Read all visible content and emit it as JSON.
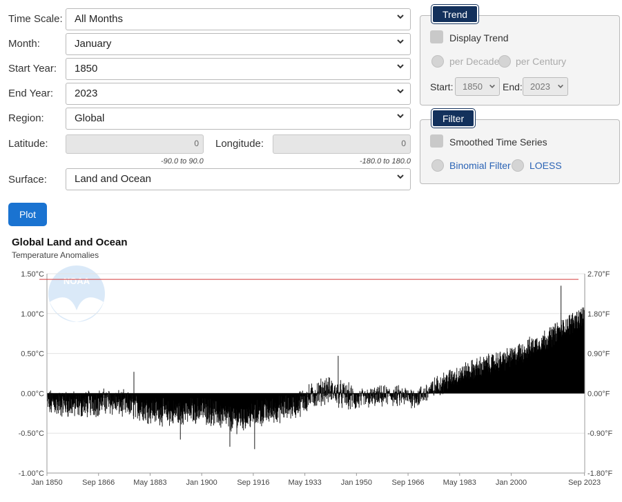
{
  "form": {
    "time_scale": {
      "label": "Time Scale:",
      "value": "All Months"
    },
    "month": {
      "label": "Month:",
      "value": "January"
    },
    "start_year": {
      "label": "Start Year:",
      "value": "1850"
    },
    "end_year": {
      "label": "End Year:",
      "value": "2023"
    },
    "region": {
      "label": "Region:",
      "value": "Global"
    },
    "latitude": {
      "label": "Latitude:",
      "value": "0",
      "hint": "-90.0 to 90.0"
    },
    "longitude": {
      "label": "Longitude:",
      "value": "0",
      "hint": "-180.0 to 180.0"
    },
    "surface": {
      "label": "Surface:",
      "value": "Land and Ocean"
    },
    "plot_label": "Plot"
  },
  "trend": {
    "tag": "Trend",
    "display_label": "Display Trend",
    "per_decade": "per Decade",
    "per_century": "per Century",
    "start_label": "Start:",
    "start_value": "1850",
    "end_label": "End:",
    "end_value": "2023"
  },
  "filter": {
    "tag": "Filter",
    "smoothed_label": "Smoothed Time Series",
    "binomial": "Binomial Filter",
    "loess": "LOESS"
  },
  "chart": {
    "title": "Global Land and Ocean",
    "subtitle": "Temperature Anomalies",
    "watermark": "NOAA"
  },
  "chart_data": {
    "type": "bar",
    "title": "Global Land and Ocean",
    "subtitle": "Temperature Anomalies",
    "y_left_ticks": [
      "1.50°C",
      "1.00°C",
      "0.50°C",
      "0.00°C",
      "-0.50°C",
      "-1.00°C"
    ],
    "y_right_ticks": [
      "2.70°F",
      "1.80°F",
      "0.90°F",
      "0.00°F",
      "-0.90°F",
      "-1.80°F"
    ],
    "x_ticks": [
      "Jan 1850",
      "Sep 1866",
      "May 1883",
      "Jan 1900",
      "Sep 1916",
      "May 1933",
      "Jan 1950",
      "Sep 1966",
      "May 1983",
      "Jan 2000",
      "Sep 2023"
    ],
    "x_tick_years": [
      1850,
      1866.67,
      1883.33,
      1900,
      1916.67,
      1933.33,
      1950,
      1966.67,
      1983.33,
      2000,
      2023.67
    ],
    "ylim": [
      -1.0,
      1.5
    ],
    "x_range": [
      1850,
      2023.75
    ],
    "reference_line_celsius": 1.43,
    "series": [
      {
        "values_by_decade_approx": [
          [
            1850,
            -0.12
          ],
          [
            1860,
            -0.15
          ],
          [
            1870,
            -0.1
          ],
          [
            1880,
            -0.18
          ],
          [
            1890,
            -0.25
          ],
          [
            1900,
            -0.2
          ],
          [
            1910,
            -0.33
          ],
          [
            1920,
            -0.24
          ],
          [
            1930,
            -0.15
          ],
          [
            1940,
            0.05
          ],
          [
            1950,
            -0.08
          ],
          [
            1960,
            -0.03
          ],
          [
            1970,
            -0.05
          ],
          [
            1980,
            0.18
          ],
          [
            1990,
            0.33
          ],
          [
            2000,
            0.45
          ],
          [
            2010,
            0.65
          ],
          [
            2020,
            0.9
          ]
        ],
        "peak_values": [
          [
            1878,
            0.27
          ],
          [
            1944,
            0.47
          ],
          [
            2016,
            1.35
          ],
          [
            2023.7,
            1.45
          ]
        ],
        "trough_values": [
          [
            1893,
            -0.58
          ],
          [
            1909,
            -0.67
          ],
          [
            1917,
            -0.7
          ]
        ]
      }
    ],
    "colors": {
      "bars": "#000000",
      "reference_line": "#d33a3a"
    },
    "grid": true
  }
}
